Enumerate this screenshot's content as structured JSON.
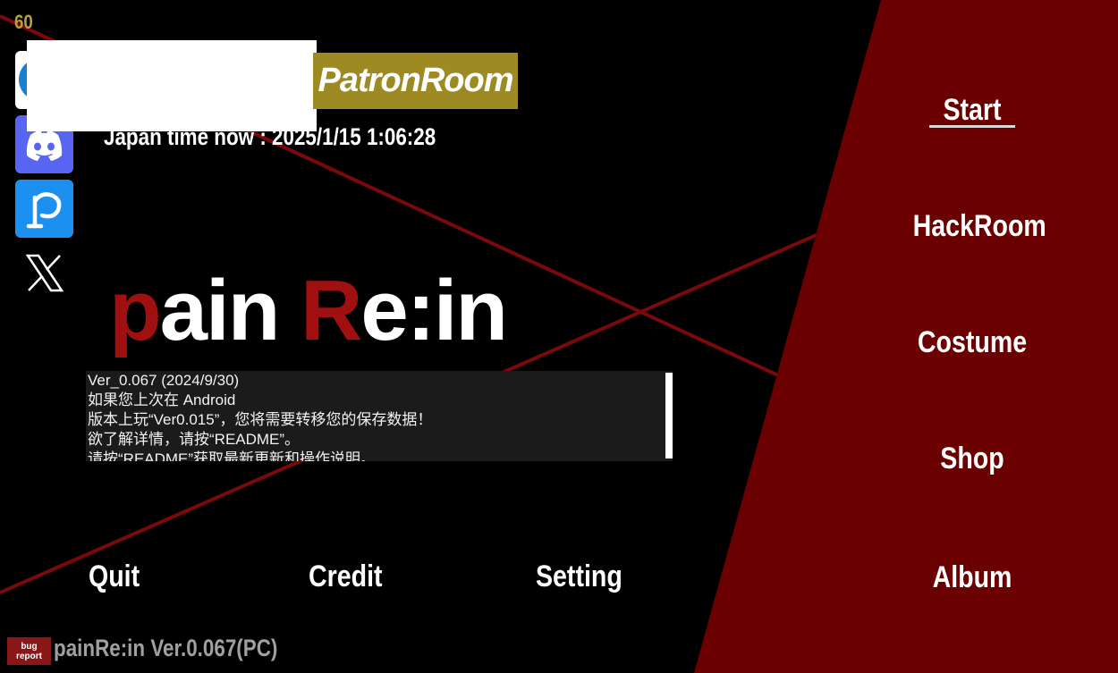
{
  "hud": {
    "fps": "60"
  },
  "header": {
    "patron_label": "PatronRoom",
    "japan_time": "Japan time now : 2025/1/15 1:06:28"
  },
  "social": [
    {
      "icon": "account-icon"
    },
    {
      "icon": "discord-icon"
    },
    {
      "icon": "pixiv-icon"
    },
    {
      "icon": "x-icon"
    }
  ],
  "logo": {
    "part1": "p",
    "part2": "ain ",
    "part3": "R",
    "part4": "e:in"
  },
  "notes": {
    "lines": [
      "Ver_0.067 (2024/9/30)",
      "如果您上次在 Android",
      "版本上玩“Ver0.015”，您将需要转移您的保存数据！",
      "欲了解详情，请按“README”。",
      "请按“README”获取最新更新和操作说明。"
    ]
  },
  "bottom_menu": {
    "quit": "Quit",
    "credit": "Credit",
    "setting": "Setting"
  },
  "side_menu": {
    "start": "Start",
    "hackroom": "HackRoom",
    "costume": "Costume",
    "shop": "Shop",
    "album": "Album"
  },
  "footer": {
    "bug_line1": "bug",
    "bug_line2": "report",
    "version": "painRe:in Ver.0.067(PC)"
  },
  "colors": {
    "panel_red": "#6b0000",
    "accent_gold": "#9d8a22",
    "logo_red": "#a01010",
    "discord": "#5865f2",
    "pixiv": "#1c90f0"
  }
}
